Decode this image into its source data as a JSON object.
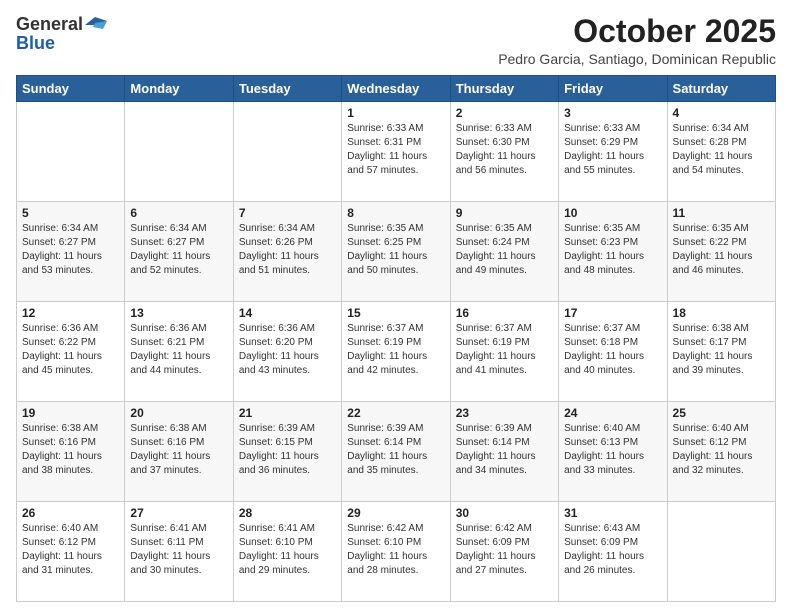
{
  "logo": {
    "general": "General",
    "blue": "Blue"
  },
  "header": {
    "month": "October 2025",
    "location": "Pedro Garcia, Santiago, Dominican Republic"
  },
  "weekdays": [
    "Sunday",
    "Monday",
    "Tuesday",
    "Wednesday",
    "Thursday",
    "Friday",
    "Saturday"
  ],
  "weeks": [
    [
      {
        "day": "",
        "sunrise": "",
        "sunset": "",
        "daylight": ""
      },
      {
        "day": "",
        "sunrise": "",
        "sunset": "",
        "daylight": ""
      },
      {
        "day": "",
        "sunrise": "",
        "sunset": "",
        "daylight": ""
      },
      {
        "day": "1",
        "sunrise": "Sunrise: 6:33 AM",
        "sunset": "Sunset: 6:31 PM",
        "daylight": "Daylight: 11 hours and 57 minutes."
      },
      {
        "day": "2",
        "sunrise": "Sunrise: 6:33 AM",
        "sunset": "Sunset: 6:30 PM",
        "daylight": "Daylight: 11 hours and 56 minutes."
      },
      {
        "day": "3",
        "sunrise": "Sunrise: 6:33 AM",
        "sunset": "Sunset: 6:29 PM",
        "daylight": "Daylight: 11 hours and 55 minutes."
      },
      {
        "day": "4",
        "sunrise": "Sunrise: 6:34 AM",
        "sunset": "Sunset: 6:28 PM",
        "daylight": "Daylight: 11 hours and 54 minutes."
      }
    ],
    [
      {
        "day": "5",
        "sunrise": "Sunrise: 6:34 AM",
        "sunset": "Sunset: 6:27 PM",
        "daylight": "Daylight: 11 hours and 53 minutes."
      },
      {
        "day": "6",
        "sunrise": "Sunrise: 6:34 AM",
        "sunset": "Sunset: 6:27 PM",
        "daylight": "Daylight: 11 hours and 52 minutes."
      },
      {
        "day": "7",
        "sunrise": "Sunrise: 6:34 AM",
        "sunset": "Sunset: 6:26 PM",
        "daylight": "Daylight: 11 hours and 51 minutes."
      },
      {
        "day": "8",
        "sunrise": "Sunrise: 6:35 AM",
        "sunset": "Sunset: 6:25 PM",
        "daylight": "Daylight: 11 hours and 50 minutes."
      },
      {
        "day": "9",
        "sunrise": "Sunrise: 6:35 AM",
        "sunset": "Sunset: 6:24 PM",
        "daylight": "Daylight: 11 hours and 49 minutes."
      },
      {
        "day": "10",
        "sunrise": "Sunrise: 6:35 AM",
        "sunset": "Sunset: 6:23 PM",
        "daylight": "Daylight: 11 hours and 48 minutes."
      },
      {
        "day": "11",
        "sunrise": "Sunrise: 6:35 AM",
        "sunset": "Sunset: 6:22 PM",
        "daylight": "Daylight: 11 hours and 46 minutes."
      }
    ],
    [
      {
        "day": "12",
        "sunrise": "Sunrise: 6:36 AM",
        "sunset": "Sunset: 6:22 PM",
        "daylight": "Daylight: 11 hours and 45 minutes."
      },
      {
        "day": "13",
        "sunrise": "Sunrise: 6:36 AM",
        "sunset": "Sunset: 6:21 PM",
        "daylight": "Daylight: 11 hours and 44 minutes."
      },
      {
        "day": "14",
        "sunrise": "Sunrise: 6:36 AM",
        "sunset": "Sunset: 6:20 PM",
        "daylight": "Daylight: 11 hours and 43 minutes."
      },
      {
        "day": "15",
        "sunrise": "Sunrise: 6:37 AM",
        "sunset": "Sunset: 6:19 PM",
        "daylight": "Daylight: 11 hours and 42 minutes."
      },
      {
        "day": "16",
        "sunrise": "Sunrise: 6:37 AM",
        "sunset": "Sunset: 6:19 PM",
        "daylight": "Daylight: 11 hours and 41 minutes."
      },
      {
        "day": "17",
        "sunrise": "Sunrise: 6:37 AM",
        "sunset": "Sunset: 6:18 PM",
        "daylight": "Daylight: 11 hours and 40 minutes."
      },
      {
        "day": "18",
        "sunrise": "Sunrise: 6:38 AM",
        "sunset": "Sunset: 6:17 PM",
        "daylight": "Daylight: 11 hours and 39 minutes."
      }
    ],
    [
      {
        "day": "19",
        "sunrise": "Sunrise: 6:38 AM",
        "sunset": "Sunset: 6:16 PM",
        "daylight": "Daylight: 11 hours and 38 minutes."
      },
      {
        "day": "20",
        "sunrise": "Sunrise: 6:38 AM",
        "sunset": "Sunset: 6:16 PM",
        "daylight": "Daylight: 11 hours and 37 minutes."
      },
      {
        "day": "21",
        "sunrise": "Sunrise: 6:39 AM",
        "sunset": "Sunset: 6:15 PM",
        "daylight": "Daylight: 11 hours and 36 minutes."
      },
      {
        "day": "22",
        "sunrise": "Sunrise: 6:39 AM",
        "sunset": "Sunset: 6:14 PM",
        "daylight": "Daylight: 11 hours and 35 minutes."
      },
      {
        "day": "23",
        "sunrise": "Sunrise: 6:39 AM",
        "sunset": "Sunset: 6:14 PM",
        "daylight": "Daylight: 11 hours and 34 minutes."
      },
      {
        "day": "24",
        "sunrise": "Sunrise: 6:40 AM",
        "sunset": "Sunset: 6:13 PM",
        "daylight": "Daylight: 11 hours and 33 minutes."
      },
      {
        "day": "25",
        "sunrise": "Sunrise: 6:40 AM",
        "sunset": "Sunset: 6:12 PM",
        "daylight": "Daylight: 11 hours and 32 minutes."
      }
    ],
    [
      {
        "day": "26",
        "sunrise": "Sunrise: 6:40 AM",
        "sunset": "Sunset: 6:12 PM",
        "daylight": "Daylight: 11 hours and 31 minutes."
      },
      {
        "day": "27",
        "sunrise": "Sunrise: 6:41 AM",
        "sunset": "Sunset: 6:11 PM",
        "daylight": "Daylight: 11 hours and 30 minutes."
      },
      {
        "day": "28",
        "sunrise": "Sunrise: 6:41 AM",
        "sunset": "Sunset: 6:10 PM",
        "daylight": "Daylight: 11 hours and 29 minutes."
      },
      {
        "day": "29",
        "sunrise": "Sunrise: 6:42 AM",
        "sunset": "Sunset: 6:10 PM",
        "daylight": "Daylight: 11 hours and 28 minutes."
      },
      {
        "day": "30",
        "sunrise": "Sunrise: 6:42 AM",
        "sunset": "Sunset: 6:09 PM",
        "daylight": "Daylight: 11 hours and 27 minutes."
      },
      {
        "day": "31",
        "sunrise": "Sunrise: 6:43 AM",
        "sunset": "Sunset: 6:09 PM",
        "daylight": "Daylight: 11 hours and 26 minutes."
      },
      {
        "day": "",
        "sunrise": "",
        "sunset": "",
        "daylight": ""
      }
    ]
  ]
}
